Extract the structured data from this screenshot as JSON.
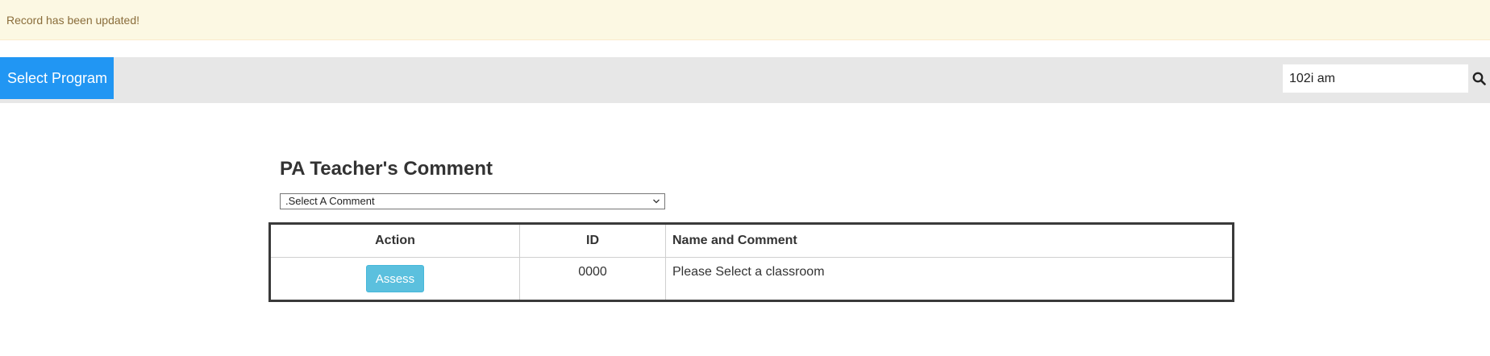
{
  "alert": {
    "message": "Record has been updated!"
  },
  "navbar": {
    "program_button_label": "Select Program",
    "search": {
      "value": "102i am",
      "icon": "search-icon"
    }
  },
  "main": {
    "title": "PA Teacher's Comment",
    "comment_select": {
      "selected": ".Select A Comment",
      "icon": "chevron-down-icon"
    },
    "table": {
      "headers": [
        "Action",
        "ID",
        "Name and Comment"
      ],
      "rows": [
        {
          "action_label": "Assess",
          "id": "0000",
          "comment": "Please Select a classroom"
        }
      ]
    }
  },
  "colors": {
    "alert_bg": "#fcf8e3",
    "alert_text": "#8a6d3b",
    "primary": "#2196f3",
    "info_button": "#5bc0de",
    "navbar_bg": "#e7e7e7"
  }
}
